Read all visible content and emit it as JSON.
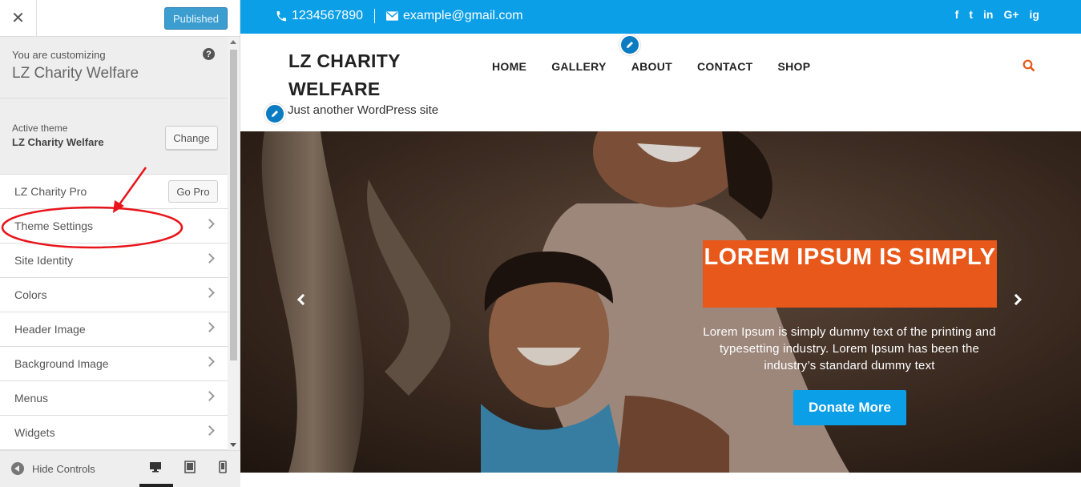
{
  "sidebar": {
    "close_icon": "close-icon",
    "publish_label": "Published",
    "customizing_label": "You are customizing",
    "site_name": "LZ Charity Welfare",
    "active_theme_label": "Active theme",
    "active_theme_name": "LZ Charity Welfare",
    "change_label": "Change",
    "pro_label": "LZ Charity Pro",
    "gopro_label": "Go Pro",
    "items": [
      {
        "label": "Theme Settings"
      },
      {
        "label": "Site Identity"
      },
      {
        "label": "Colors"
      },
      {
        "label": "Header Image"
      },
      {
        "label": "Background Image"
      },
      {
        "label": "Menus"
      },
      {
        "label": "Widgets"
      }
    ],
    "hide_controls_label": "Hide Controls",
    "annotation_color": "#e8141a"
  },
  "preview": {
    "phone": "1234567890",
    "email": "example@gmail.com",
    "social": [
      "f",
      "t",
      "in",
      "G+",
      "ig"
    ],
    "site_title": "LZ CHARITY WELFARE",
    "tagline": "Just another WordPress site",
    "nav": [
      "HOME",
      "GALLERY",
      "ABOUT",
      "CONTACT",
      "SHOP"
    ],
    "hero_title": "LOREM IPSUM IS SIMPLY",
    "hero_text": "Lorem Ipsum is simply dummy text of the printing and typesetting industry. Lorem Ipsum has been the industry’s standard dummy text",
    "donate_label": "Donate More",
    "accent": "#0b9fe8",
    "orange": "#e8581a"
  }
}
